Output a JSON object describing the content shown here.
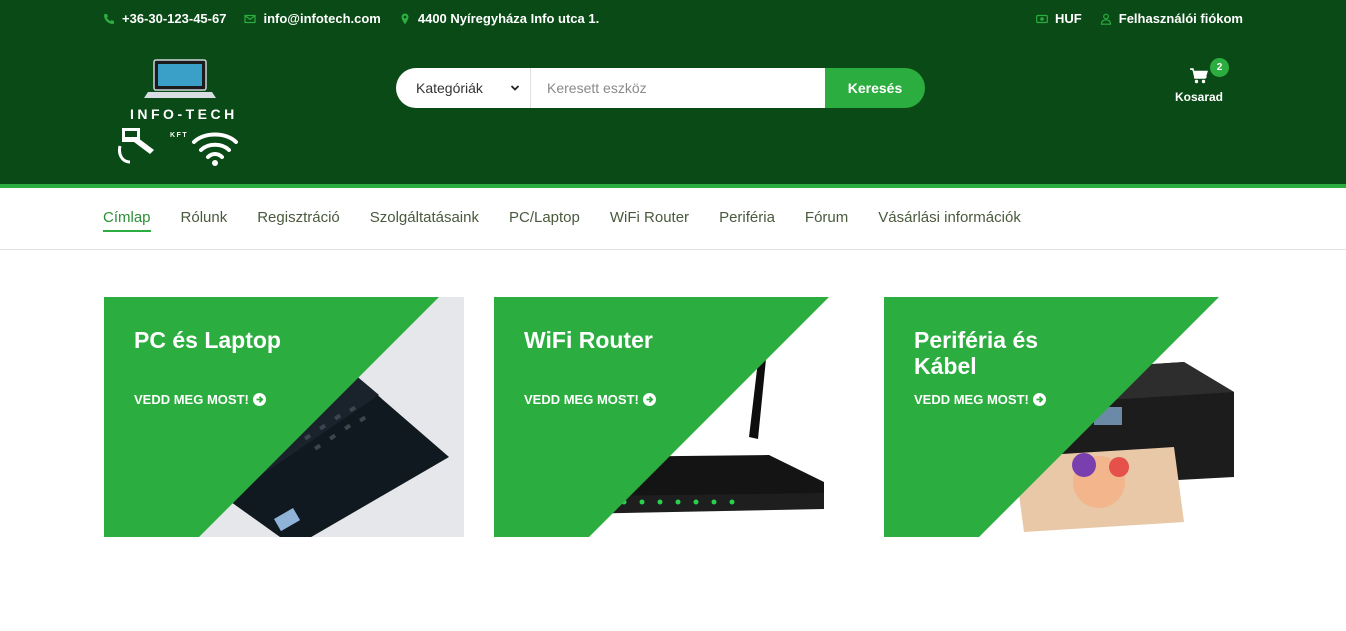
{
  "topbar": {
    "phone": "+36-30-123-45-67",
    "email": "info@infotech.com",
    "address": "4400 Nyíregyháza Info utca 1.",
    "currency": "HUF",
    "account": "Felhasználói fiókom"
  },
  "logo": {
    "text": "INFO-TECH",
    "sub": "KFT"
  },
  "search": {
    "category": "Kategóriák",
    "placeholder": "Keresett eszköz",
    "button": "Keresés"
  },
  "cart": {
    "count": "2",
    "label": "Kosarad"
  },
  "nav": {
    "items": [
      {
        "label": "Címlap"
      },
      {
        "label": "Rólunk"
      },
      {
        "label": "Regisztráció"
      },
      {
        "label": "Szolgáltatásaink"
      },
      {
        "label": "PC/Laptop"
      },
      {
        "label": "WiFi Router"
      },
      {
        "label": "Periféria"
      },
      {
        "label": "Fórum"
      },
      {
        "label": "Vásárlási információk"
      }
    ]
  },
  "banners": [
    {
      "title": "PC és Laptop",
      "cta": "VEDD MEG MOST!"
    },
    {
      "title": "WiFi Router",
      "cta": "VEDD MEG MOST!"
    },
    {
      "title": "Periféria és Kábel",
      "cta": "VEDD MEG MOST!"
    }
  ],
  "colors": {
    "dark_green": "#0a4a16",
    "accent_green": "#2bad3f"
  }
}
